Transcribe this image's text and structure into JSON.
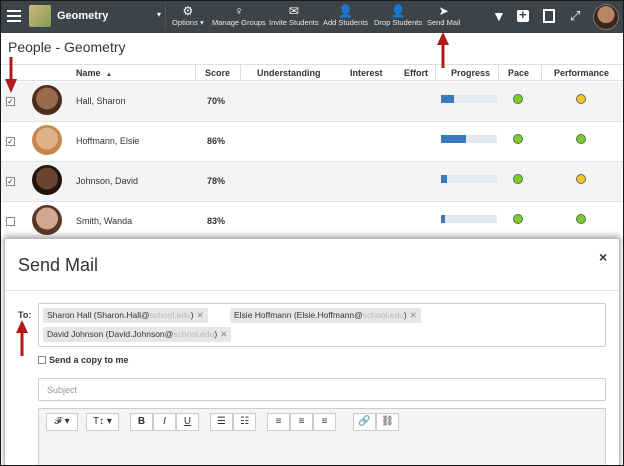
{
  "topbar": {
    "course": "Geometry",
    "tools": [
      {
        "label": "Options",
        "icon": "⚙"
      },
      {
        "label": "Manage Groups",
        "icon": "♀"
      },
      {
        "label": "Invite Students",
        "icon": "✉"
      },
      {
        "label": "Add Students",
        "icon": "👤"
      },
      {
        "label": "Drop Students",
        "icon": "👤"
      },
      {
        "label": "Send Mail",
        "icon": "➤"
      }
    ],
    "options_caret": "▾"
  },
  "page_title": "People - Geometry",
  "table": {
    "headers": {
      "name": "Name",
      "sort": "▲",
      "score": "Score",
      "understanding": "Understanding",
      "interest": "Interest",
      "effort": "Effort",
      "progress": "Progress",
      "pace": "Pace",
      "performance": "Performance"
    },
    "rows": [
      {
        "name": "Hall, Sharon",
        "score": "70%",
        "checked": true,
        "progress": 0.23,
        "pace": "green",
        "performance": "yellow",
        "face": "#9a6a4c"
      },
      {
        "name": "Hoffmann, Elsie",
        "score": "86%",
        "checked": true,
        "progress": 0.45,
        "pace": "green",
        "performance": "green",
        "face": "#d8a476"
      },
      {
        "name": "Johnson, David",
        "score": "78%",
        "checked": true,
        "progress": 0.1,
        "pace": "green",
        "performance": "yellow",
        "face": "#5a3a28"
      },
      {
        "name": "Smith, Wanda",
        "score": "83%",
        "checked": false,
        "progress": 0.07,
        "pace": "green",
        "performance": "green",
        "face": "#c79a80"
      }
    ]
  },
  "modal": {
    "title": "Send Mail",
    "close": "×",
    "to_label": "To:",
    "recipients": [
      {
        "name": "Sharon Hall (Sharon.Hall@",
        "domain": "school.edu",
        "close": ")"
      },
      {
        "name": "Elsie Hoffmann (Elsie.Hoffmann@",
        "domain": "school.edu",
        "close": ")"
      },
      {
        "name": "David Johnson (David.Johnson@",
        "domain": "school.edu",
        "close": ")"
      }
    ],
    "copy_label": "Send a copy to me",
    "subject_placeholder": "Subject",
    "editor_tools": [
      "𝓕 ▾",
      "T↕ ▾",
      "B",
      "I",
      "U",
      "☰",
      "☷",
      "≡",
      "≡",
      "≡",
      "🔗",
      "⛓"
    ]
  },
  "colors": {
    "green": "#7ccd2a",
    "yellow": "#f5c623",
    "progress": "#3a79bd",
    "arrow": "#b21a1a"
  }
}
